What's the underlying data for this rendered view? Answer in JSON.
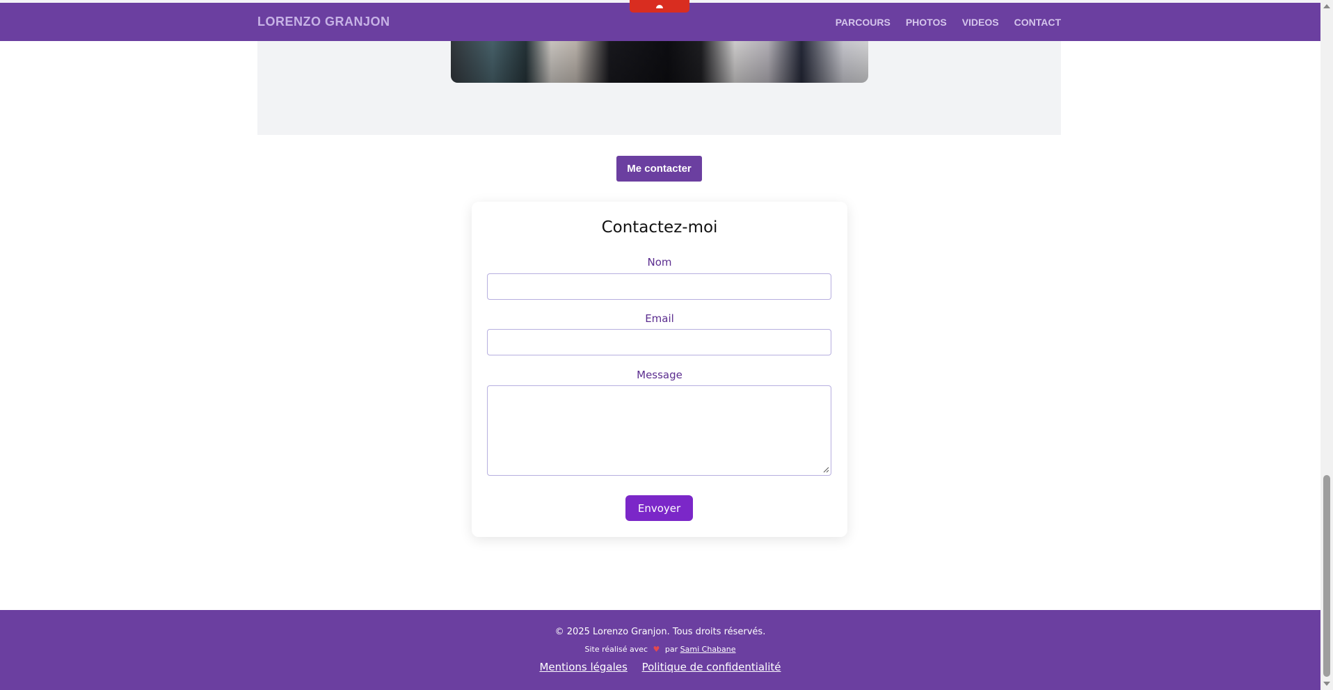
{
  "header": {
    "brand": "LORENZO GRANJON",
    "nav": [
      "PARCOURS",
      "PHOTOS",
      "VIDEOS",
      "CONTACT"
    ]
  },
  "hero": {
    "cta_label": "Me contacter"
  },
  "contact_form": {
    "title": "Contactez-moi",
    "name_label": "Nom",
    "name_value": "",
    "email_label": "Email",
    "email_value": "",
    "message_label": "Message",
    "message_value": "",
    "submit_label": "Envoyer"
  },
  "footer": {
    "copyright": "© 2025 Lorenzo Granjon. Tous droits réservés.",
    "made_with_prefix": "Site réalisé avec",
    "heart_icon": "♥",
    "made_with_by": "par",
    "author_link": "Sami Chabane",
    "legal_links": [
      "Mentions légales",
      "Politique de confidentialité"
    ]
  },
  "colors": {
    "brand": "#6b3fa0",
    "submit": "#7b27c8",
    "label": "#5b2d8f",
    "heart": "#e5484d"
  }
}
